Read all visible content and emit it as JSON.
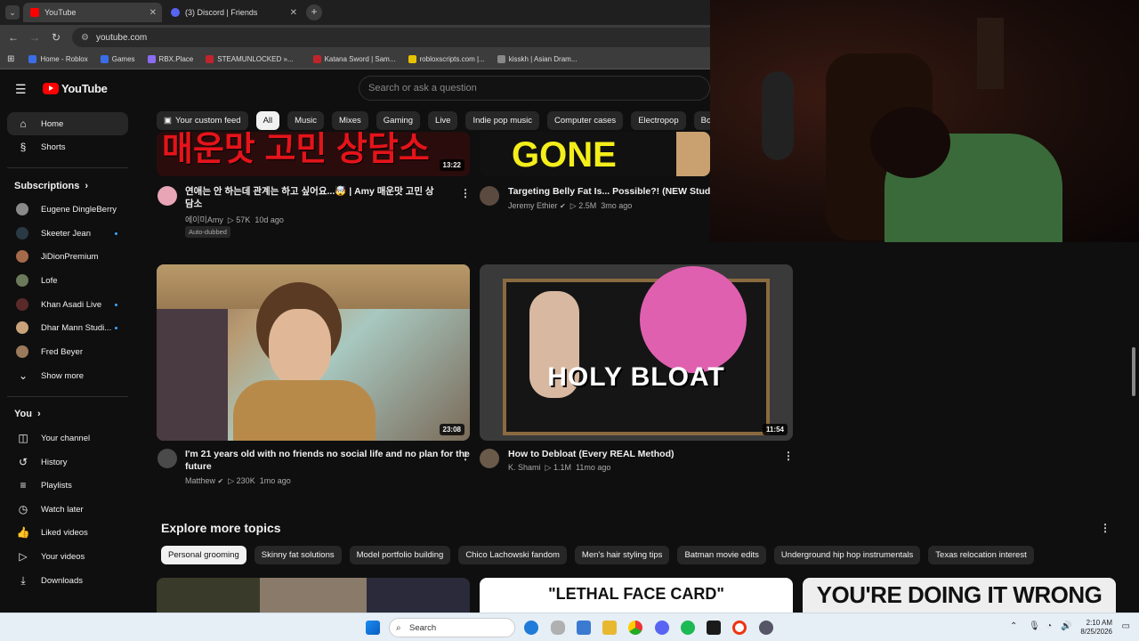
{
  "browser": {
    "tabs": [
      {
        "title": "YouTube",
        "active": true
      },
      {
        "title": "(3) Discord | Friends",
        "active": false
      }
    ],
    "url": "youtube.com",
    "bookmarks": [
      "Home - Roblox",
      "Games",
      "RBX.Place",
      "STEAMUNLOCKED »...",
      "Katana Sword | Sam...",
      "robloxscripts.com |...",
      "kisskh | Asian Dram..."
    ]
  },
  "yt": {
    "logo": "YouTube",
    "search_placeholder": "Search or ask a question",
    "chips": [
      "Your custom feed",
      "All",
      "Music",
      "Mixes",
      "Gaming",
      "Live",
      "Indie pop music",
      "Computer cases",
      "Electropop",
      "Body"
    ],
    "active_chip": "All"
  },
  "sidebar": {
    "home": "Home",
    "shorts": "Shorts",
    "subscriptions_title": "Subscriptions",
    "subscriptions": [
      "Eugene DingleBerry",
      "Skeeter Jean",
      "JiDionPremium",
      "Lofe",
      "Khan Asadi Live",
      "Dhar Mann Studi...",
      "Fred Beyer"
    ],
    "show_more": "Show more",
    "you_title": "You",
    "you_items": [
      "Your channel",
      "History",
      "Playlists",
      "Watch later",
      "Liked videos",
      "Your videos",
      "Downloads"
    ]
  },
  "videos": [
    {
      "thumb_text": "매운맛 고민 상담소",
      "duration": "13:22",
      "title_1": "연애는 안 하는데 관계는 하고 싶어요...🤯 | Amy 매운맛 고민 상",
      "title_2": "담소",
      "channel": "에이미Amy",
      "views": "57K",
      "age": "10d ago",
      "badge": "Auto-dubbed"
    },
    {
      "thumb_text": "GONE",
      "title_1": "Targeting Belly Fat Is... Possible?! (NEW Study)",
      "channel": "Jeremy Ethier",
      "views": "2.5M",
      "age": "3mo ago"
    },
    {
      "duration": "23:08",
      "title_1": "I'm 21 years old with no friends no social life and no plan for the",
      "title_2": "future",
      "channel": "Matthew",
      "views": "230K",
      "age": "1mo ago"
    },
    {
      "thumb_text": "HOLY BLOAT",
      "duration": "11:54",
      "title_1": "How to Debloat (Every REAL Method)",
      "channel": "K. Shami",
      "views": "1.1M",
      "age": "11mo ago"
    }
  ],
  "explore": {
    "title": "Explore more topics",
    "chips": [
      "Personal grooming",
      "Skinny fat solutions",
      "Model portfolio building",
      "Chico Lachowski fandom",
      "Men's hair styling tips",
      "Batman movie edits",
      "Underground hip hop instrumentals",
      "Texas relocation interest"
    ],
    "thumb2": "\"LETHAL FACE CARD\"",
    "thumb3": "YOU'RE DOING IT WRONG"
  },
  "taskbar": {
    "search": "Search",
    "time": "2:10 AM",
    "date": "8/25/2026"
  }
}
